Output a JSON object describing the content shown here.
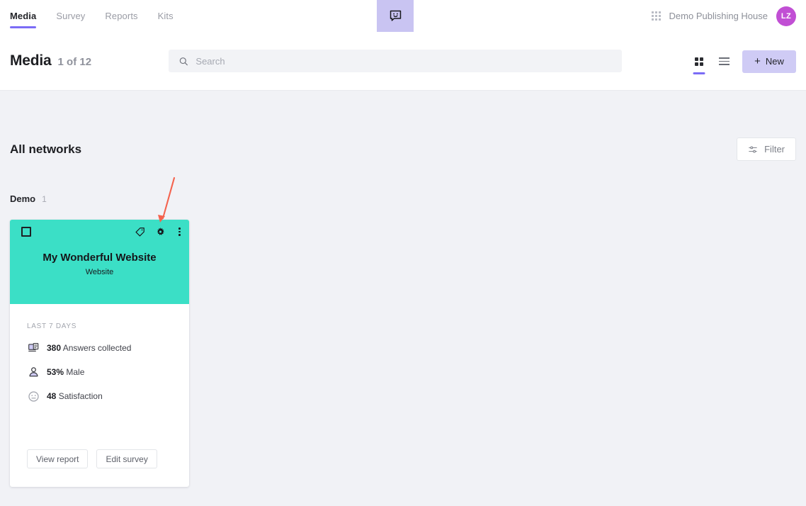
{
  "topnav": {
    "tabs": [
      {
        "label": "Media",
        "active": true
      },
      {
        "label": "Survey",
        "active": false
      },
      {
        "label": "Reports",
        "active": false
      },
      {
        "label": "Kits",
        "active": false
      }
    ],
    "chat_icon": "chat-smiley-icon",
    "apps_icon": "grid-apps-icon",
    "org_name": "Demo Publishing House",
    "avatar_initials": "LZ",
    "avatar_color": "#C14FD4",
    "accent_color": "#7B6CF6",
    "chat_block_color": "#C9C4F2"
  },
  "header": {
    "title": "Media",
    "count": "1 of 12",
    "search": {
      "placeholder": "Search",
      "value": "",
      "icon": "search-icon"
    },
    "view_grid_icon": "grid-view-icon",
    "view_list_icon": "list-view-icon",
    "new_button": {
      "label": "New",
      "plus": "+",
      "color": "#CFCBF5"
    }
  },
  "main": {
    "section_title": "All networks",
    "filter_button": {
      "label": "Filter",
      "icon": "filter-sliders-icon"
    },
    "group": {
      "name": "Demo",
      "count": "1"
    },
    "card": {
      "banner_color": "#3BDFC6",
      "title": "My Wonderful Website",
      "subtitle": "Website",
      "checkbox_checked": false,
      "tag_icon": "tag-icon",
      "settings_icon": "gear-icon",
      "more_icon": "more-vertical-icon",
      "stats_label": "LAST 7 DAYS",
      "stats": [
        {
          "icon": "screen-answers-icon",
          "value": "380",
          "label": "Answers collected"
        },
        {
          "icon": "person-gender-icon",
          "value": "53%",
          "label": "Male"
        },
        {
          "icon": "smiley-neutral-icon",
          "value": "48",
          "label": "Satisfaction"
        }
      ],
      "actions": [
        {
          "label": "View report"
        },
        {
          "label": "Edit survey"
        }
      ]
    }
  },
  "annotation": {
    "arrow_color": "#F4634E",
    "points_to": "gear-icon"
  }
}
